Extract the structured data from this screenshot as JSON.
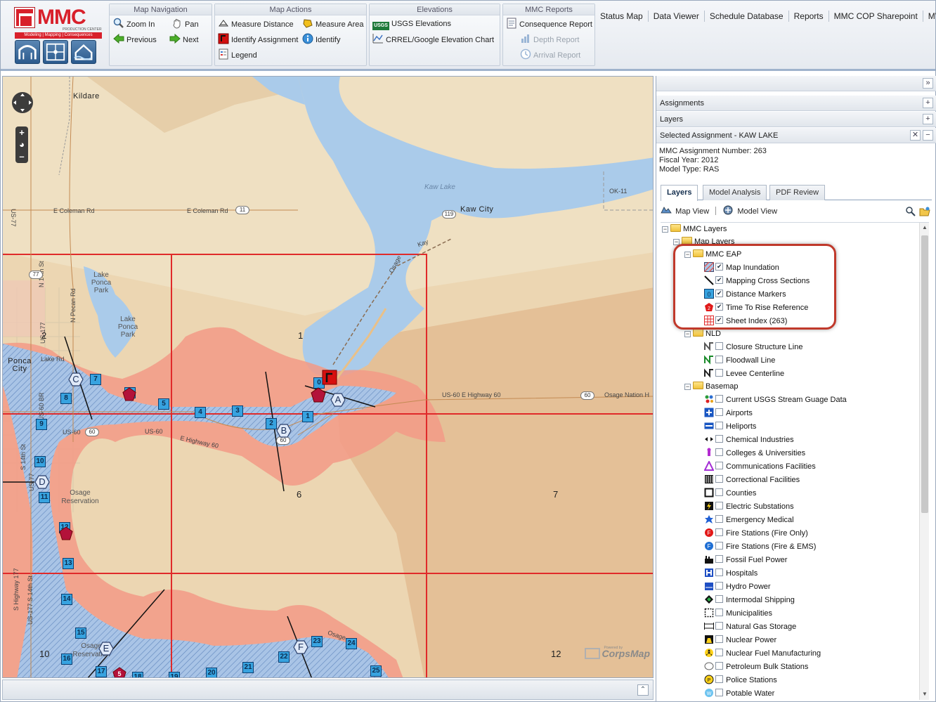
{
  "logo": {
    "word": "MMC",
    "sub1": "PRODUCTION CENTER",
    "sub2": "Modeling | Mapping | Consequences"
  },
  "toolbar": {
    "map_navigation": {
      "title": "Map Navigation",
      "zoom_in": "Zoom In",
      "pan": "Pan",
      "previous": "Previous",
      "next": "Next"
    },
    "map_actions": {
      "title": "Map Actions",
      "measure_distance": "Measure Distance",
      "measure_area": "Measure Area",
      "identify_assignment": "Identify Assignment",
      "identify": "Identify",
      "legend": "Legend"
    },
    "elevations": {
      "title": "Elevations",
      "usgs": "USGS Elevations",
      "usgs_badge": "USGS",
      "crrel": "CRREL/Google Elevation Chart"
    },
    "mmc_reports": {
      "title": "MMC Reports",
      "consequence": "Consequence Report",
      "depth": "Depth Report",
      "arrival": "Arrival Report"
    }
  },
  "nav_tabs": [
    "Status Map",
    "Data Viewer",
    "Schedule Database",
    "Reports",
    "MMC COP Sharepoint",
    "MVK"
  ],
  "map": {
    "labels": {
      "kildare": "Kildare",
      "kaw_lake": "Kaw Lake",
      "kaw_city": "Kaw City",
      "lake_ponca_park": "Lake Ponca Park",
      "lake_ponca_park2": "Lake Ponca Park",
      "ponca_city": "Ponca City",
      "osage_reservation": "Osage Reservation",
      "osage_reservation2": "Osage Reservation",
      "ok11": "OK-11",
      "kay": "Kay",
      "osage1": "Osage",
      "osage2": "Osage",
      "e_coleman_rd": "E Coleman Rd",
      "e_coleman_rd2": "E Coleman Rd",
      "us60_e_hwy60": "US-60 E Highway 60",
      "osage_nation": "Osage Nation H",
      "us60": "US-60",
      "us60b": "US-60",
      "e_hwy60": "E Highway 60",
      "lake_rd": "Lake Rd",
      "us77": "US-77",
      "n14th": "N 14th St",
      "npecan": "N Pecan Rd",
      "us177": "US-177",
      "s14th": "S 14th St",
      "us60br": "US-60 BR",
      "us77b": "US-77",
      "s_hwy177": "S Highway 177",
      "us177b": "US-177 S 14th St",
      "shield_11": "11",
      "shield_119": "119",
      "shield_77": "77",
      "shield_60": "60",
      "shield_60b": "60",
      "shield_60c": "60"
    },
    "sheets": [
      "1",
      "2",
      "6",
      "7",
      "10",
      "12"
    ],
    "distance_markers": [
      "0",
      "1",
      "2",
      "3",
      "4",
      "5",
      "6",
      "7",
      "8",
      "9",
      "10",
      "11",
      "12",
      "13",
      "14",
      "15",
      "16",
      "17",
      "18",
      "19",
      "20",
      "21",
      "22",
      "23",
      "24",
      "25"
    ],
    "cross_sections": [
      "A",
      "B",
      "C",
      "D",
      "E",
      "F"
    ],
    "time_to_rise": [
      "5"
    ],
    "attribution": "CorpsMap",
    "attribution_small": "Powered by"
  },
  "panel": {
    "assignments": "Assignments",
    "layers": "Layers",
    "selected": "Selected Assignment - KAW LAKE",
    "info": {
      "number": "MMC Assignment Number: 263",
      "year": "Fiscal Year: 2012",
      "model": "Model Type: RAS"
    },
    "tabs": [
      "Layers",
      "Model Analysis",
      "PDF Review"
    ],
    "map_view": "Map View",
    "model_view": "Model View",
    "tree": {
      "root": "MMC Layers",
      "map_layers": "Map Layers",
      "mmc_eap": "MMC EAP",
      "eap_layers": [
        {
          "name": "Map Inundation",
          "checked": true,
          "icon": "inundation-icon"
        },
        {
          "name": "Mapping Cross Sections",
          "checked": true,
          "icon": "cross-section-icon"
        },
        {
          "name": "Distance Markers",
          "checked": true,
          "icon": "distance-marker-icon"
        },
        {
          "name": "Time To Rise Reference",
          "checked": true,
          "icon": "time-to-rise-icon"
        },
        {
          "name": "Sheet Index (263)",
          "checked": true,
          "icon": "sheet-index-icon"
        }
      ],
      "nld": "NLD",
      "nld_layers": [
        "Closure Structure Line",
        "Floodwall Line",
        "Levee Centerline"
      ],
      "basemap": "Basemap",
      "basemap_layers": [
        "Current USGS Stream Guage Data",
        "Airports",
        "Heliports",
        "Chemical Industries",
        "Colleges & Universities",
        "Communications Facilities",
        "Correctional Facilities",
        "Counties",
        "Electric Substations",
        "Emergency Medical",
        "Fire Stations (Fire Only)",
        "Fire Stations (Fire & EMS)",
        "Fossil Fuel Power",
        "Hospitals",
        "Hydro Power",
        "Intermodal Shipping",
        "Municipalities",
        "Natural Gas Storage",
        "Nuclear Power",
        "Nuclear Fuel Manufacturing",
        "Petroleum Bulk Stations",
        "Police Stations",
        "Potable Water"
      ]
    }
  }
}
